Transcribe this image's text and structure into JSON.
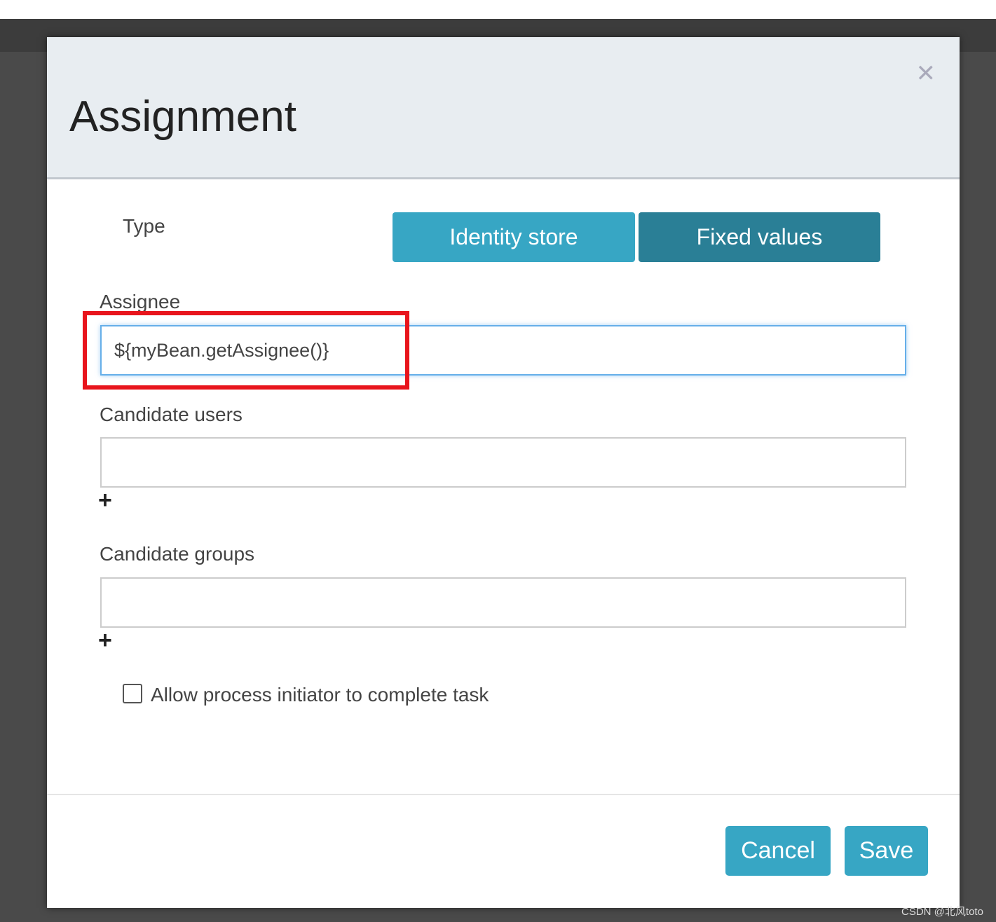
{
  "dialog": {
    "title": "Assignment",
    "close_icon": "close-icon"
  },
  "type": {
    "label": "Type",
    "options": [
      "Identity store",
      "Fixed values"
    ],
    "selected": "Fixed values"
  },
  "assignee": {
    "label": "Assignee",
    "value": "${myBean.getAssignee()}"
  },
  "candidate_users": {
    "label": "Candidate users",
    "value": "",
    "add_icon": "plus-icon"
  },
  "candidate_groups": {
    "label": "Candidate groups",
    "value": "",
    "add_icon": "plus-icon"
  },
  "allow_initiator": {
    "label": "Allow process initiator to complete task",
    "checked": false
  },
  "footer": {
    "cancel": "Cancel",
    "save": "Save"
  },
  "watermark": "CSDN @北风toto",
  "colors": {
    "primary": "#37a6c4",
    "selected": "#2a7f96",
    "highlight": "#e8141c"
  }
}
